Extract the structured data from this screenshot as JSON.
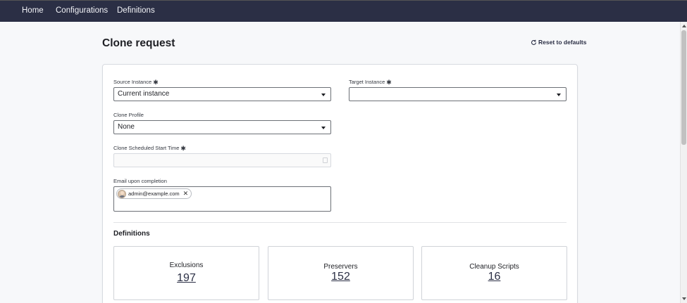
{
  "nav": {
    "items": [
      {
        "label": "Home"
      },
      {
        "label": "Configurations"
      },
      {
        "label": "Definitions"
      }
    ]
  },
  "page": {
    "title": "Clone request",
    "reset_label": "Reset to defaults"
  },
  "form": {
    "required_marker": "✱",
    "source_instance": {
      "label": "Source Instance",
      "value": "Current instance"
    },
    "target_instance": {
      "label": "Target Instance",
      "value": ""
    },
    "clone_profile": {
      "label": "Clone Profile",
      "value": "None"
    },
    "scheduled_start": {
      "label": "Clone Scheduled Start Time",
      "value": ""
    },
    "email": {
      "label": "Email upon completion",
      "chips": [
        {
          "email": "admin@example.com"
        }
      ],
      "remove_glyph": "✕"
    }
  },
  "definitions": {
    "title": "Definitions",
    "cards": [
      {
        "label": "Exclusions",
        "count": "197"
      },
      {
        "label": "Preservers",
        "count": "152"
      },
      {
        "label": "Cleanup Scripts",
        "count": "16"
      }
    ]
  },
  "colors": {
    "nav_bg": "#2b2f45",
    "accent": "#2b2f45",
    "page_bg": "#f7f8fa"
  }
}
